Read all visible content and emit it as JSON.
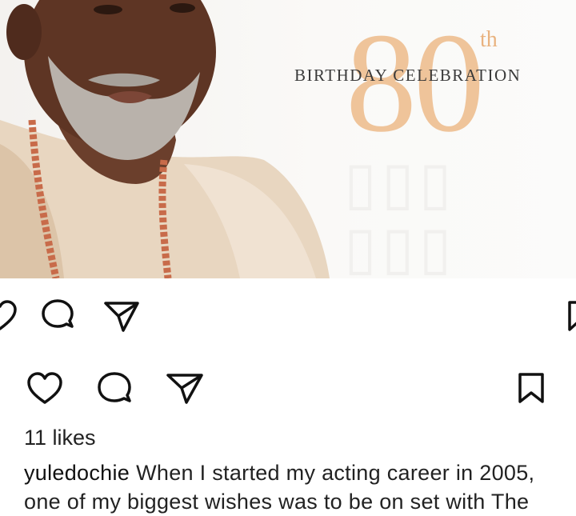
{
  "post_image": {
    "celebration_ordinal": "80",
    "celebration_suffix": "th",
    "celebration_text": "BIRTHDAY CELEBRATION"
  },
  "actions": {
    "like_icon": "heart-outline-icon",
    "comment_icon": "comment-bubble-icon",
    "share_icon": "paper-plane-icon",
    "save_icon": "bookmark-outline-icon"
  },
  "post": {
    "likes": "11 likes",
    "username": "yuledochie",
    "caption_line_1": "When I started my acting career in 2005,",
    "caption_line_2": "one of my biggest wishes was to be on set with The"
  },
  "colors": {
    "accent_gold": "#efc49a",
    "icon_stroke": "#111111"
  }
}
